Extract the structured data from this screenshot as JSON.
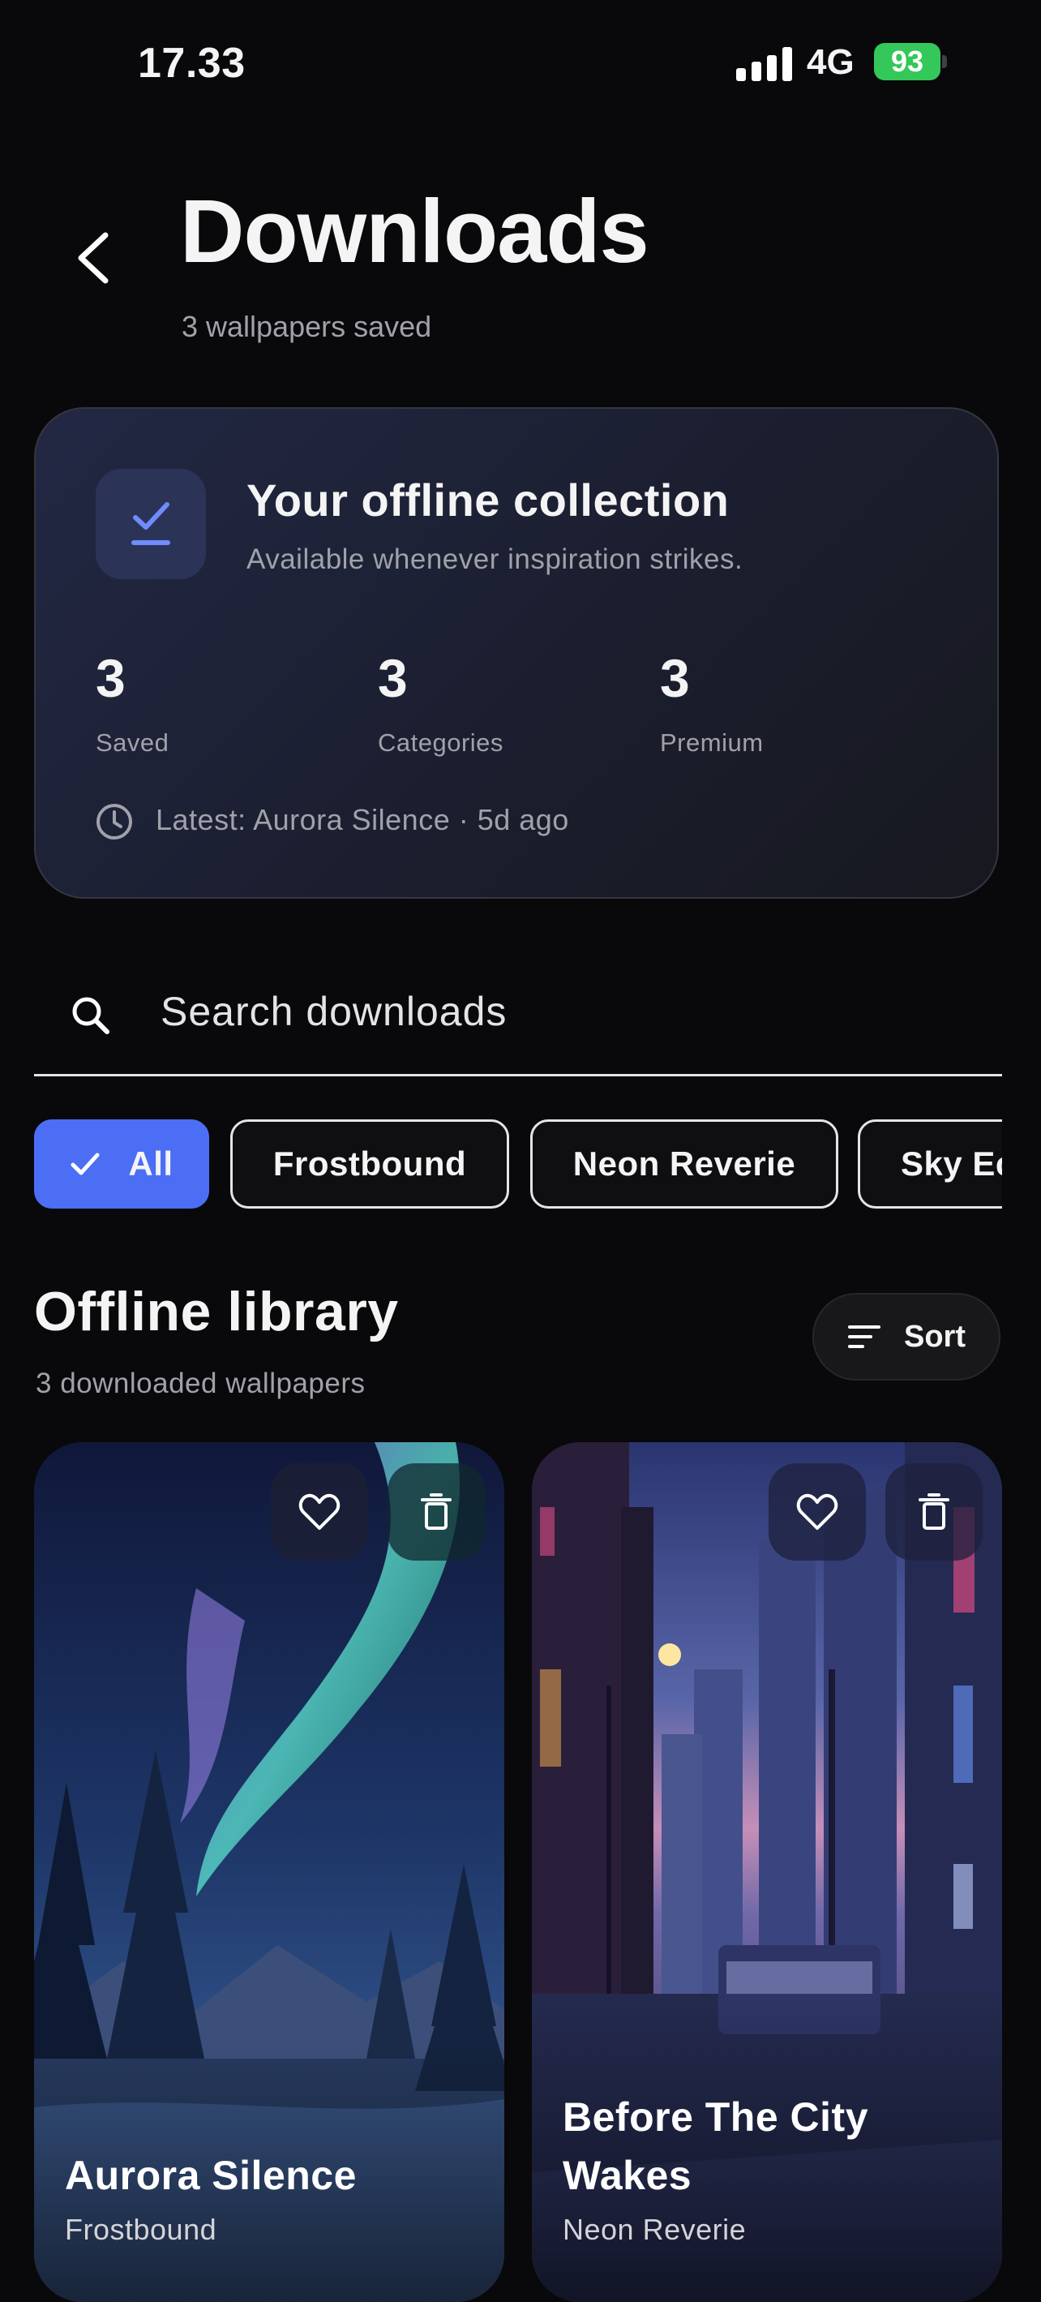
{
  "status_bar": {
    "time": "17.33",
    "network": "4G",
    "battery": "93"
  },
  "header": {
    "title": "Downloads",
    "subtitle": "3 wallpapers saved"
  },
  "collection": {
    "title": "Your offline collection",
    "subtitle": "Available whenever inspiration strikes.",
    "stats": [
      {
        "value": "3",
        "label": "Saved"
      },
      {
        "value": "3",
        "label": "Categories"
      },
      {
        "value": "3",
        "label": "Premium"
      }
    ],
    "latest": "Latest: Aurora Silence · 5d ago"
  },
  "search": {
    "placeholder": "Search downloads",
    "value": ""
  },
  "filters": {
    "chips": [
      "All",
      "Frostbound",
      "Neon Reverie",
      "Sky Echoes"
    ],
    "active": "All"
  },
  "library": {
    "title": "Offline library",
    "subtitle": "3 downloaded wallpapers",
    "sort_label": "Sort"
  },
  "wallpapers": [
    {
      "name": "Aurora Silence",
      "category": "Frostbound"
    },
    {
      "name": "Before The City Wakes",
      "category": "Neon Reverie"
    }
  ],
  "colors": {
    "accent": "#4c6ef5",
    "battery": "#34c759",
    "background": "#09090b"
  }
}
